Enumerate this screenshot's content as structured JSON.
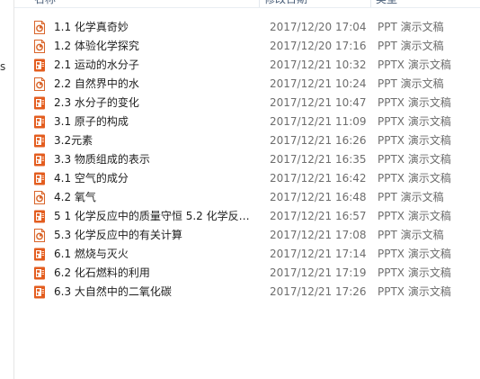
{
  "header": {
    "name_label": "名称",
    "date_label": "修改日期",
    "type_label": "类型"
  },
  "left_pane": {
    "stub_text": "s"
  },
  "files": [
    {
      "name": "1.1 化学真奇妙",
      "date": "2017/12/20 17:04",
      "type": "PPT 演示文稿",
      "icon": "ppt-file-icon"
    },
    {
      "name": "1.2  体验化学探究",
      "date": "2017/12/20 17:16",
      "type": "PPT 演示文稿",
      "icon": "ppt-file-icon"
    },
    {
      "name": "2.1 运动的水分子",
      "date": "2017/12/21 10:32",
      "type": "PPTX 演示文稿",
      "icon": "pptx-file-icon"
    },
    {
      "name": "2.2  自然界中的水",
      "date": "2017/12/21 10:24",
      "type": "PPT 演示文稿",
      "icon": "ppt-file-icon"
    },
    {
      "name": "2.3 水分子的变化",
      "date": "2017/12/21 10:47",
      "type": "PPTX 演示文稿",
      "icon": "pptx-file-icon"
    },
    {
      "name": "3.1 原子的构成",
      "date": "2017/12/21 11:09",
      "type": "PPTX 演示文稿",
      "icon": "pptx-file-icon"
    },
    {
      "name": "3.2元素",
      "date": "2017/12/21 16:26",
      "type": "PPTX 演示文稿",
      "icon": "pptx-file-icon"
    },
    {
      "name": "3.3 物质组成的表示",
      "date": "2017/12/21 16:35",
      "type": "PPTX 演示文稿",
      "icon": "pptx-file-icon"
    },
    {
      "name": "4.1 空气的成分",
      "date": "2017/12/21 16:42",
      "type": "PPTX 演示文稿",
      "icon": "pptx-file-icon"
    },
    {
      "name": "4.2  氧气",
      "date": "2017/12/21 16:48",
      "type": "PPT 演示文稿",
      "icon": "ppt-file-icon"
    },
    {
      "name": "5 1 化学反应中的质量守恒  5.2 化学反…",
      "date": "2017/12/21 16:57",
      "type": "PPTX 演示文稿",
      "icon": "pptx-file-icon"
    },
    {
      "name": "5.3  化学反应中的有关计算",
      "date": "2017/12/21 17:08",
      "type": "PPT 演示文稿",
      "icon": "ppt-file-icon"
    },
    {
      "name": "6.1  燃烧与灭火",
      "date": "2017/12/21 17:14",
      "type": "PPTX 演示文稿",
      "icon": "pptx-file-icon"
    },
    {
      "name": "6.2  化石燃料的利用",
      "date": "2017/12/21 17:19",
      "type": "PPTX 演示文稿",
      "icon": "pptx-file-icon"
    },
    {
      "name": "6.3  大自然中的二氧化碳",
      "date": "2017/12/21 17:26",
      "type": "PPTX 演示文稿",
      "icon": "pptx-file-icon"
    }
  ],
  "colors": {
    "ppt_icon": "#d9652b",
    "pptx_icon_bg": "#e35d1f",
    "header_text": "#4c607a",
    "meta_text": "#6d6d6d"
  }
}
